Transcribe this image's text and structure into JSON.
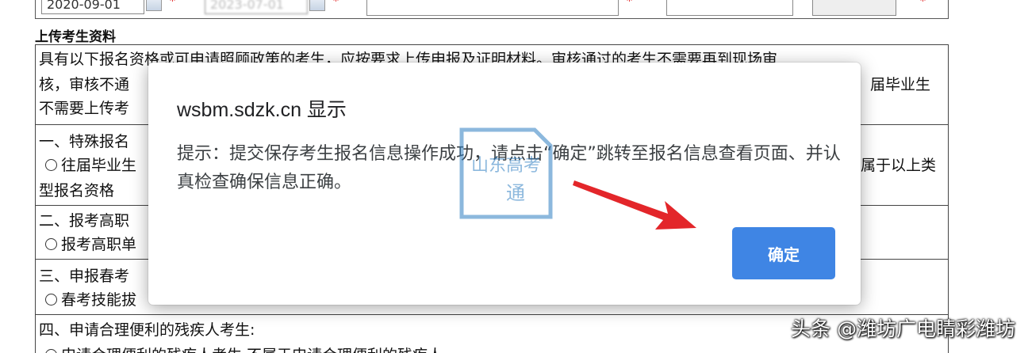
{
  "top_row": {
    "start_date": "2020-09-01",
    "end_date": "2023-07-01",
    "school_field": "",
    "blank_field": "",
    "last_field": "",
    "required_mark": "*"
  },
  "section_title": "上传考生资料",
  "form_rows": {
    "intro_line1": "具有以下报名资格或可申请照顾政策的考生，应按要求上传申报及证明材料。审核通过的考生不需要再到现场审",
    "intro_line2": "核，审核不通",
    "intro_line2_right": "届毕业生",
    "intro_line3": "不需要上传考",
    "special_title": "一、特殊报名",
    "special_option": "往届毕业生",
    "special_option_right": "属于以上类",
    "special_line3": "型报名资格",
    "vocational_title": "二、报考高职",
    "vocational_option": "报考高职单",
    "spring_title": "三、申报春考",
    "spring_option": "春考技能拔",
    "disabled_title": "四、申请合理便利的残疾人考生:",
    "disabled_option": "申请合理便利的残疾人考生  不属于申请合理便利的残疾人"
  },
  "dialog": {
    "title": "wsbm.sdzk.cn 显示",
    "message": "提示：提交保存考生报名信息操作成功，请点击“确定”跳转至报名信息查看页面、并认真检查确保信息正确。",
    "ok_label": "确定"
  },
  "watermark": {
    "line1": "山东高考",
    "line2": "通"
  },
  "caption": "头条 @潍坊广电睛彩潍坊",
  "colors": {
    "button": "#3f85e4",
    "arrow": "#e3262a",
    "watermark": "#2f7fc3"
  }
}
